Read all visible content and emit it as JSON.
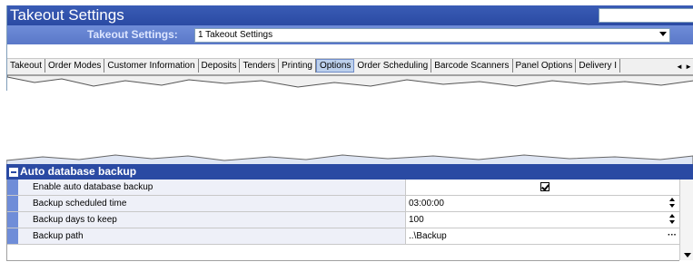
{
  "window": {
    "title": "Takeout Settings"
  },
  "selector": {
    "label": "Takeout Settings:",
    "value": "1 Takeout Settings"
  },
  "tabs": [
    {
      "label": "Takeout"
    },
    {
      "label": "Order Modes"
    },
    {
      "label": "Customer Information"
    },
    {
      "label": "Deposits"
    },
    {
      "label": "Tenders"
    },
    {
      "label": "Printing"
    },
    {
      "label": "Options",
      "active": true
    },
    {
      "label": "Order Scheduling"
    },
    {
      "label": "Barcode Scanners"
    },
    {
      "label": "Panel Options"
    },
    {
      "label": "Delivery I"
    }
  ],
  "tab_scroll": {
    "left": "◄",
    "right": "►"
  },
  "section": {
    "title": "Auto database backup",
    "rows": [
      {
        "name": "Enable auto database backup",
        "value": "",
        "checked": true
      },
      {
        "name": "Backup scheduled time",
        "value": "03:00:00"
      },
      {
        "name": "Backup days to keep",
        "value": "100"
      },
      {
        "name": "Backup path",
        "value": "..\\Backup",
        "ellipsis": "···"
      }
    ]
  },
  "colors": {
    "title_bar": "#2a4aa3",
    "selector_bar": "#6f8dd8",
    "row_gutter": "#6f8dd8"
  }
}
